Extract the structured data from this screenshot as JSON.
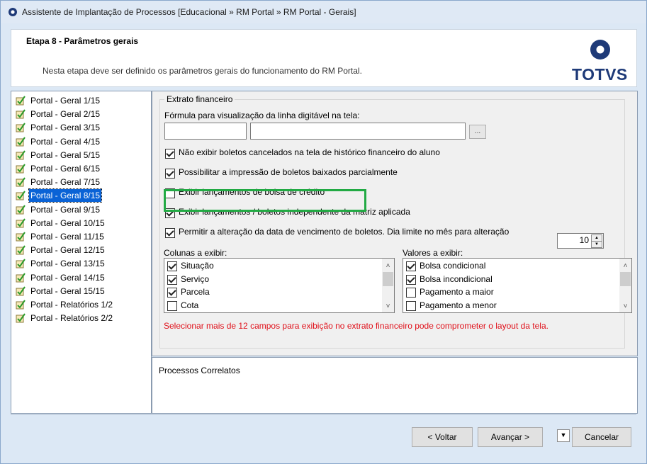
{
  "window": {
    "title": "Assistente de Implantação de Processos [Educacional » RM Portal » RM Portal - Gerais]"
  },
  "header": {
    "step_title": "Etapa 8 - Parâmetros gerais",
    "description": "Nesta etapa deve ser definido os parâmetros gerais do funcionamento do RM Portal.",
    "logo_text": "TOTVS"
  },
  "steps": [
    {
      "label": "Portal - Geral 1/15"
    },
    {
      "label": "Portal - Geral 2/15"
    },
    {
      "label": "Portal - Geral 3/15"
    },
    {
      "label": "Portal - Geral 4/15"
    },
    {
      "label": "Portal - Geral 5/15"
    },
    {
      "label": "Portal - Geral 6/15"
    },
    {
      "label": "Portal - Geral 7/15"
    },
    {
      "label": "Portal - Geral 8/15",
      "selected": true
    },
    {
      "label": "Portal - Geral 9/15"
    },
    {
      "label": "Portal - Geral 10/15"
    },
    {
      "label": "Portal - Geral 11/15"
    },
    {
      "label": "Portal - Geral 12/15"
    },
    {
      "label": "Portal - Geral 13/15"
    },
    {
      "label": "Portal - Geral 14/15"
    },
    {
      "label": "Portal - Geral 15/15"
    },
    {
      "label": "Portal - Relatórios 1/2"
    },
    {
      "label": "Portal - Relatórios 2/2"
    }
  ],
  "extrato": {
    "legend": "Extrato financeiro",
    "formula_label": "Fórmula para visualização da linha digitável na tela:",
    "formula_code": "",
    "formula_text": "",
    "browse_label": "...",
    "options": [
      {
        "label": "Não exibir boletos cancelados na tela de histórico financeiro do aluno",
        "checked": true
      },
      {
        "label": "Possibilitar a impressão de boletos baixados parcialmente",
        "checked": true
      },
      {
        "label": "Exibir lançamentos de bolsa de crédito",
        "checked": false
      },
      {
        "label": "Exibir lançamentos / boletos independente da matriz aplicada",
        "checked": true
      },
      {
        "label": "Permitir a alteração da data de vencimento de boletos. Dia limite no mês para alteração",
        "checked": true
      }
    ],
    "day_limit": "10",
    "columns_label": "Colunas a exibir:",
    "columns": [
      {
        "label": "Situação",
        "checked": true
      },
      {
        "label": "Serviço",
        "checked": true
      },
      {
        "label": "Parcela",
        "checked": true
      },
      {
        "label": "Cota",
        "checked": false
      }
    ],
    "values_label": "Valores a exibir:",
    "values": [
      {
        "label": "Bolsa condicional",
        "checked": true
      },
      {
        "label": "Bolsa incondicional",
        "checked": true
      },
      {
        "label": "Pagamento a maior",
        "checked": false
      },
      {
        "label": "Pagamento a menor",
        "checked": false
      }
    ],
    "warning": "Selecionar mais de 12 campos para exibição no extrato financeiro pode comprometer o layout da tela."
  },
  "related": {
    "title": "Processos Correlatos"
  },
  "footer": {
    "back_label": "< Voltar",
    "next_label": "Avançar >",
    "cancel_label": "Cancelar"
  },
  "colors": {
    "accent": "#0a63d6",
    "highlight": "#22aa44",
    "warning": "#e0101a",
    "brand": "#1e3a78"
  }
}
